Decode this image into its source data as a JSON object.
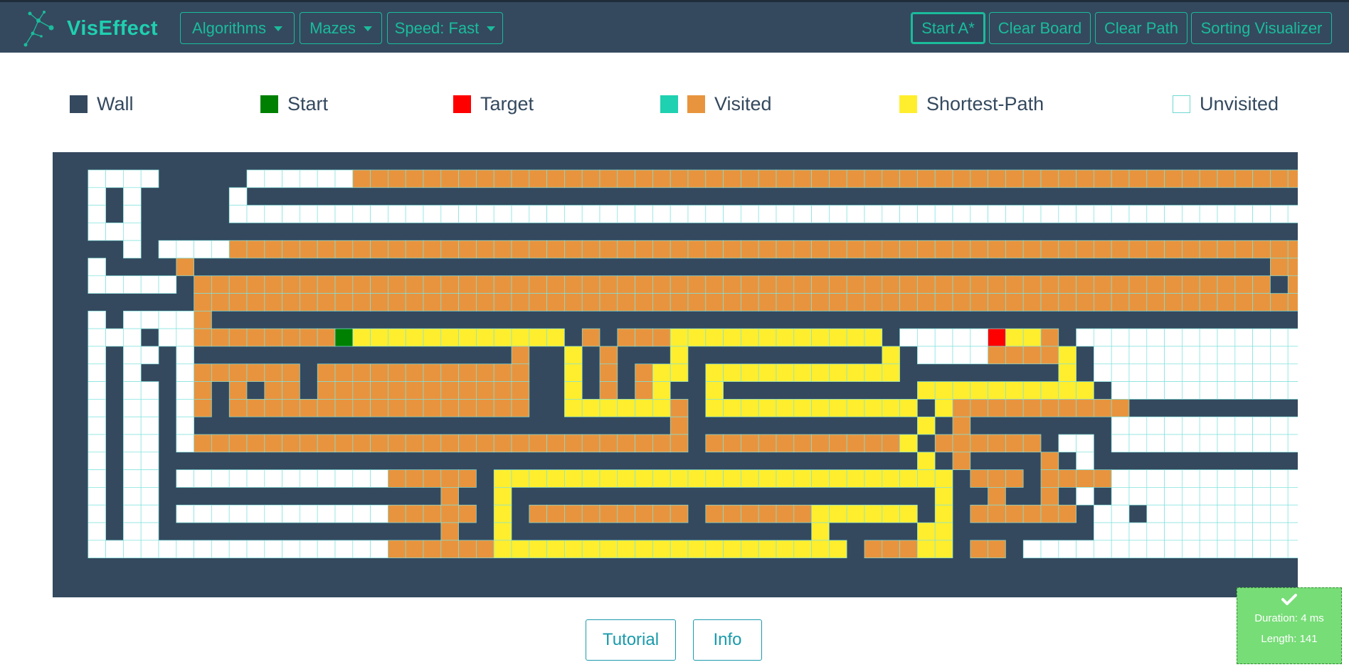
{
  "app": {
    "title": "VisEffect"
  },
  "navbar": {
    "algorithms": "Algorithms",
    "mazes": "Mazes",
    "speed": "Speed: Fast",
    "start": "Start A*",
    "clear_board": "Clear Board",
    "clear_path": "Clear Path",
    "sorting": "Sorting Visualizer"
  },
  "legend": {
    "wall": "Wall",
    "start": "Start",
    "target": "Target",
    "visited": "Visited",
    "shortest": "Shortest-Path",
    "unvisited": "Unvisited"
  },
  "colors": {
    "wall": "#34495e",
    "start": "#008000",
    "target": "#ff0000",
    "visited_a": "#1fd1b0",
    "visited_b": "#e8943e",
    "path": "#ffee2e",
    "unvisited": "#ffffff",
    "gridline": "#7fe2dc",
    "accent": "#1abc9c"
  },
  "grid": {
    "cols": 70,
    "rows": 23,
    "cells": [
      "WUUUUWWWWWUUUUUUVVVVVVVVVVVVVVVVVVVVVVVVVVVVVVVVVVVVVVVVVVVVVVVVVVVVVVVV",
      "WUWUWWWWWUWWWWWWWWWWWWWWWWWWWWWWWWWWWWWWWWWWWWWWWWWWWWWWWWWWWWWWWWWWWWVW",
      "WUWUWWWWWUUUUUUUUUUUUUUUUUUUUUUUUUUUUUUUUUUUUUUUUUUUUUUUUUUUUUUUUUUUUUVW",
      "WUUUWWWWWWWWWWWWWWWWWWWWWWWWWWWWWWWWWWWWWWWWWWWWWWWWWWWWWWWWWWWWWWWWWWVW",
      "WWWUWUUUUVVVVVVVVVVVVVVVVVVVVVVVVVVVVVVVVVVVVVVVVVVVVVVVVVVVVVVVVVVVVVW",
      "WUWWWWVWWWWWWWWWWWWWWWWWWWWWWWWWWWWWWWWWWWWWWWWWWWWWWWWWWWWWWWWWWWWWVVW",
      "WUUUUUWVVVVVVVVVVVVVVVVVVVVVVVVVVVVVVVVVVVVVVVVVVVVVVVVVVVVVVVVVVVVVWVW",
      "WWWWWWWVVVVVVVVVVVVVVVVVVVVVVVVVVVVVVVVVVVVVVVVVVVVVVVVVVVVVVVVVVVVVVVW",
      "WUWUUUUVWWWWWWWWWWWWWWWWWWWWWWWWWWWWWWWWWWWWWWWWWWWWWWWWWWWWWWWWWWWWWWW",
      "WUUUWUUVVVVVVVVSPPPPPPPPPPPPWVWVVVPPPPPPPPPPPPWUUUUUTPPVWUUUUUUUUUUUUUUWW",
      "WUWUUWUWWWWWWWWWWWWWWWWWWVWWPWVWWWPWWWWWWWWWWWPWUUUUVVVVPWUUUUUUUUUUUUWW",
      "WUWUWWUVVVVVVWVVVVVVVVVVVVWWPWVWVPPWPPPPPPPPPPPWWWWWWWWWPWUUUUUUUUUUUUUWW",
      "WUWUUWUVWVWVVWVVVVVVVVVVVVWWPWVWVPWWPWWWWWWWWWWWPPPPPPPPPPWUUUUUUUUUUUUUW",
      "WUWUUWUVWVVVVVVVVVVVVVVVVVWWPPPPPPVWPPPPPPPPPPPPWPVVVVVVVVVVWWWWWWWWWWWWUW",
      "WUWUUWUWWWWWWWWWWWWWWWWWWWWWWWWWWWVWWWWWWWWWWWWWPWVWWWWWWWWUUUUUUUUUUUUW",
      "WUWUUWUVVVVVVVVVVVVVVVVVVVVVVVVVVVVWVVVVVVVVVVVPWVVVVVVWUUWUUUUUUUUUUUUW",
      "WUWUUWWWWWWWWWWWWWWWWWWWWWWWWWWWWWWWWWWWWWWWWWWWPWVWWWWVWUWWWWWWWWWWWWUW",
      "WUWUUWUUUUUUUUUUUUVVVVVWPPPPPPPPPPPPPPPPPPPPPPPPPPWVVVWVVVVUUUUUUUUUUUUW",
      "WUWUUWWWWWWWWWWWWWWWWVWWPWWWWWWWWWWWWWWWWWWWWWWWWPWWVWWVWUWUUUUUUUUUUUW",
      "WUWUUWUUUUUUUUUUUUVVVVVWPWVVVVVVVVVWVVVVVVPPPPPPWPWVVVVVVWUUWUUUUUUUUUUW",
      "WUWUUWWWWWWWWWWWWWWWWVWWPWWWWWWWWWWWWWWWWWPWWWWWPPWWWWWWWWUUUUUUUUUUUUUW",
      "WUUUUUUUUUUUUUUUUUVVVVVVPPPPPPPPPPPPPPPPPPPPWVVVPPWVVWUUUUUUUUUUUUUUUUUW",
      "WWWWWWWWWWWWWWWWWWWWWWWWWWWWWWWWWWWWWWWWWWWWWWWWWWWWWWWWWWWWWWWWWWWWWWWW"
    ]
  },
  "buttons": {
    "tutorial": "Tutorial",
    "info": "Info"
  },
  "toast": {
    "duration": "Duration: 4 ms",
    "length": "Length: 141"
  }
}
